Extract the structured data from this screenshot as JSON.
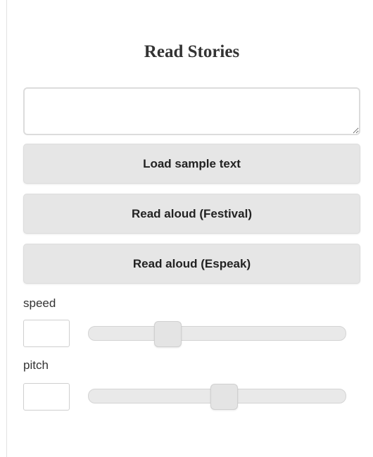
{
  "page": {
    "title": "Read Stories"
  },
  "story_input": {
    "value": "",
    "placeholder": ""
  },
  "buttons": {
    "load_sample": "Load sample text",
    "read_festival": "Read aloud (Festival)",
    "read_espeak": "Read aloud (Espeak)"
  },
  "speed": {
    "label": "speed",
    "value": "",
    "slider_fraction": 0.2
  },
  "pitch": {
    "label": "pitch",
    "value": "",
    "slider_fraction": 0.5
  }
}
